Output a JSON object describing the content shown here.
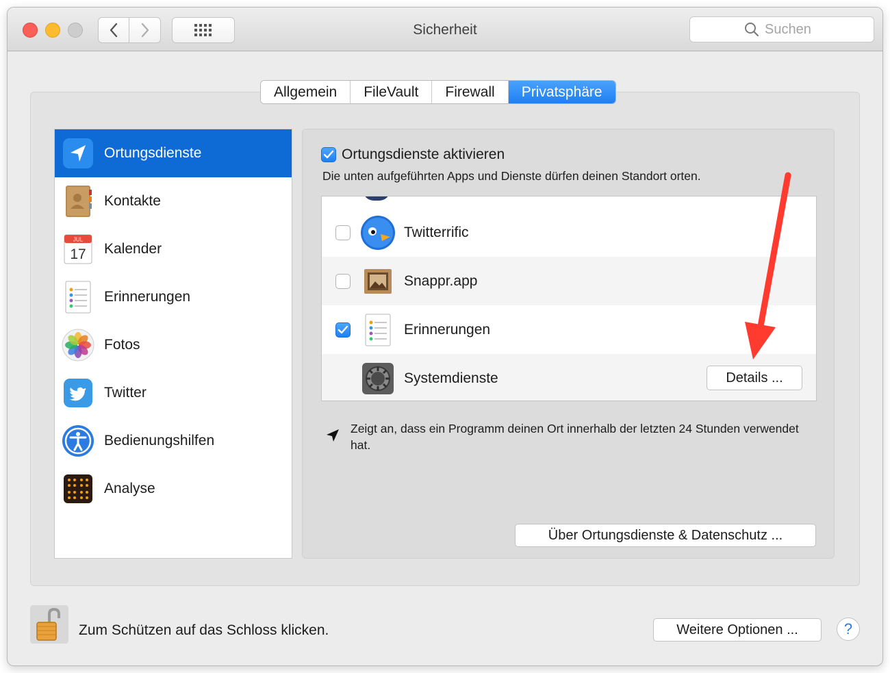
{
  "window": {
    "title": "Sicherheit"
  },
  "search": {
    "placeholder": "Suchen"
  },
  "tabs": [
    {
      "label": "Allgemein"
    },
    {
      "label": "FileVault"
    },
    {
      "label": "Firewall"
    },
    {
      "label": "Privatsphäre",
      "selected": true
    }
  ],
  "sidebar": {
    "items": [
      {
        "label": "Ortungsdienste",
        "icon": "location-arrow-icon",
        "selected": true
      },
      {
        "label": "Kontakte",
        "icon": "contacts-book-icon"
      },
      {
        "label": "Kalender",
        "icon": "calendar-icon",
        "month": "JUL",
        "day": "17"
      },
      {
        "label": "Erinnerungen",
        "icon": "reminders-list-icon"
      },
      {
        "label": "Fotos",
        "icon": "photos-flower-icon"
      },
      {
        "label": "Twitter",
        "icon": "twitter-bird-icon"
      },
      {
        "label": "Bedienungshilfen",
        "icon": "accessibility-icon"
      },
      {
        "label": "Analyse",
        "icon": "analytics-grid-icon"
      }
    ]
  },
  "panel": {
    "enable_label": "Ortungsdienste aktivieren",
    "enable_checked": true,
    "description": "Die unten aufgeführten Apps und Dienste dürfen deinen Standort orten.",
    "apps": [
      {
        "label": "Twitterrific",
        "checked": false,
        "icon": "twitterrific-bird-icon"
      },
      {
        "label": "Snappr.app",
        "checked": false,
        "icon": "snappr-frame-icon"
      },
      {
        "label": "Erinnerungen",
        "checked": true,
        "icon": "reminders-list-icon"
      },
      {
        "label": "Systemdienste",
        "icon": "system-gear-icon",
        "button_label": "Details ..."
      }
    ],
    "note": "Zeigt an, dass ein Programm deinen Ort innerhalb der letzten 24 Stunden verwendet hat.",
    "about_button": "Über Ortungsdienste & Datenschutz ..."
  },
  "footer": {
    "lock_text": "Zum Schützen auf das Schloss klicken.",
    "more_button": "Weitere Optionen ...",
    "help_label": "?"
  },
  "colors": {
    "accent": "#1d7ff5",
    "sidebar_selected": "#0e6bd6",
    "annotation_arrow": "#ff3b2f"
  }
}
